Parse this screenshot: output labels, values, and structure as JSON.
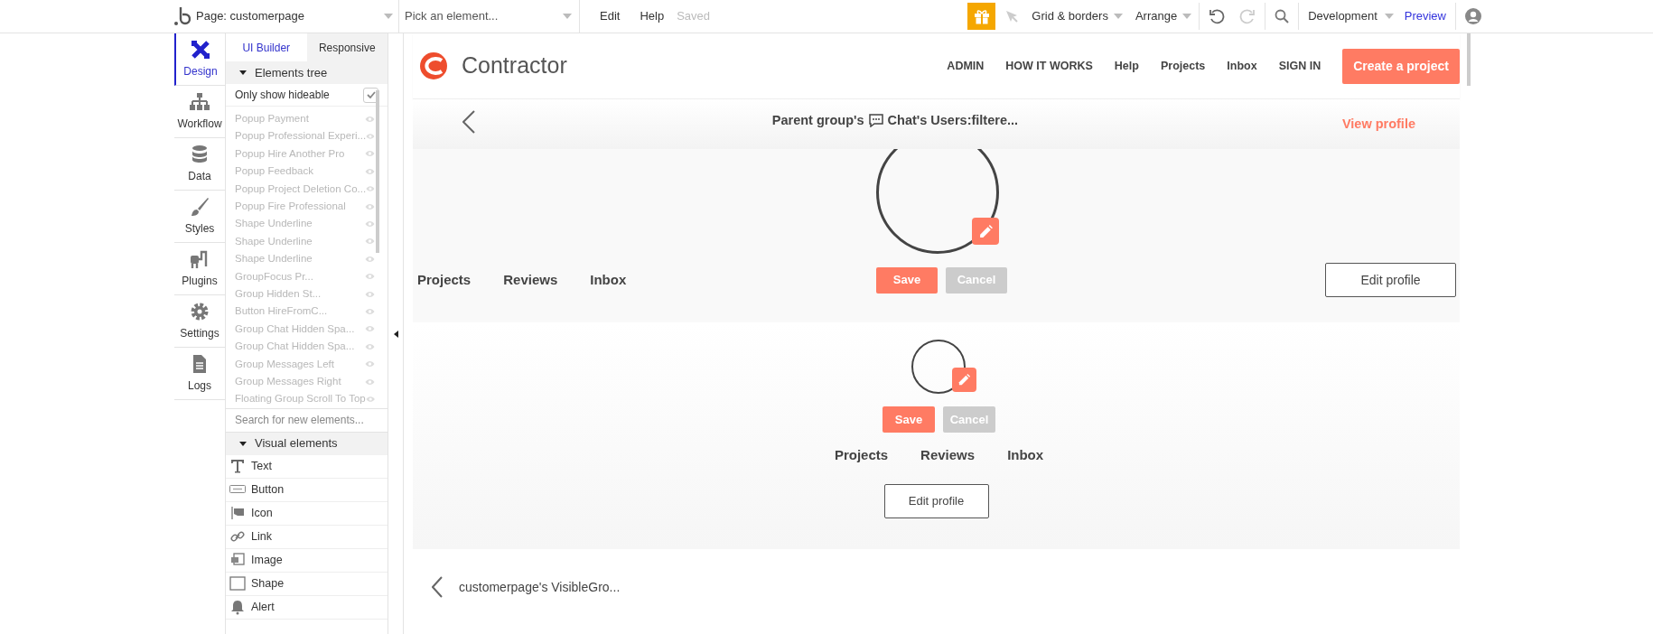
{
  "topbar": {
    "page_selector": "Page: customerpage",
    "element_picker": "Pick an element...",
    "menu": [
      "Edit",
      "Help"
    ],
    "save_status": "Saved",
    "tools": [
      "Grid & borders",
      "Arrange"
    ],
    "environment": "Development",
    "preview": "Preview"
  },
  "sidebar_tabs": [
    {
      "label": "Design",
      "selected": true
    },
    {
      "label": "Workflow",
      "selected": false
    },
    {
      "label": "Data",
      "selected": false
    },
    {
      "label": "Styles",
      "selected": false
    },
    {
      "label": "Plugins",
      "selected": false
    },
    {
      "label": "Settings",
      "selected": false
    },
    {
      "label": "Logs",
      "selected": false
    }
  ],
  "panel": {
    "tabs": [
      {
        "label": "UI Builder",
        "selected": true
      },
      {
        "label": "Responsive",
        "selected": false
      }
    ],
    "elements_tree": {
      "title": "Elements tree",
      "expanded": true,
      "filter": {
        "label": "Only show hideable",
        "checked": true
      },
      "items": [
        "Popup Payment",
        "Popup Professional Experi...",
        "Popup Hire Another Pro",
        "Popup Feedback",
        "Popup Project Deletion Co...",
        "Popup Fire Professional",
        "Shape Underline",
        "Shape Underline",
        "Shape Underline",
        "GroupFocus Pr...",
        "Group Hidden St...",
        "Button HireFromC...",
        "Group Chat Hidden Spa...",
        "Group Chat Hidden Spa...",
        "Group Messages Left",
        "Group Messages Right",
        "Floating Group Scroll To Top"
      ]
    },
    "search": {
      "placeholder": "Search for new elements..."
    },
    "visual_elements": {
      "title": "Visual elements",
      "expanded": true,
      "items": [
        {
          "kind": "text",
          "label": "Text"
        },
        {
          "kind": "button",
          "label": "Button"
        },
        {
          "kind": "icon",
          "label": "Icon"
        },
        {
          "kind": "link",
          "label": "Link"
        },
        {
          "kind": "image",
          "label": "Image"
        },
        {
          "kind": "shape",
          "label": "Shape"
        },
        {
          "kind": "alert",
          "label": "Alert"
        }
      ]
    }
  },
  "canvas": {
    "header": {
      "logo": "Contractor",
      "nav": [
        "ADMIN",
        "HOW IT WORKS",
        "Help",
        "Projects",
        "Inbox",
        "SIGN IN"
      ],
      "cta": "Create a project"
    },
    "group_bar": {
      "title_start": "Parent group's",
      "title_end": "Chat's Users:filtere...",
      "link": "View profile"
    },
    "profile_wide": {
      "tabs": [
        "Projects",
        "Reviews",
        "Inbox"
      ],
      "save": "Save",
      "cancel": "Cancel",
      "edit": "Edit profile"
    },
    "profile_narrow": {
      "tabs": [
        "Projects",
        "Reviews",
        "Inbox"
      ],
      "save": "Save",
      "cancel": "Cancel",
      "edit": "Edit profile"
    },
    "footer_group": {
      "title": "customerpage's VisibleGro..."
    }
  }
}
